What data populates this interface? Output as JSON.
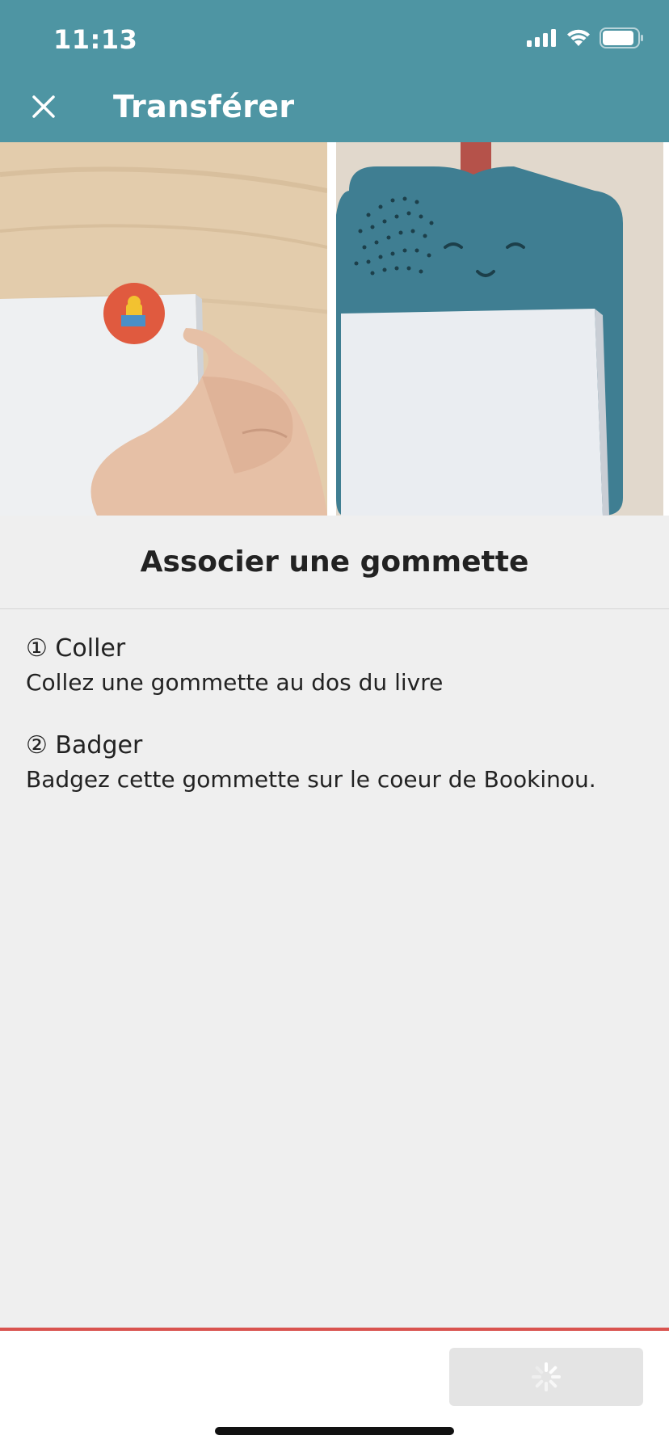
{
  "status_bar": {
    "time": "11:13",
    "icons": [
      "cellular-signal-icon",
      "wifi-icon",
      "battery-icon"
    ]
  },
  "nav": {
    "close_icon": "close-icon",
    "title": "Transférer"
  },
  "images": {
    "left": "photo of hand sticking sticker on book back",
    "right": "photo of book on blue Bookinou device"
  },
  "step": {
    "title": "Associer une gommette"
  },
  "instructions": [
    {
      "heading": "① Coller",
      "text": "Collez une gommette au dos du livre"
    },
    {
      "heading": "② Badger",
      "text": "Badgez cette gommette sur le coeur de Bookinou."
    }
  ],
  "footer": {
    "next_button_state": "loading",
    "spinner_icon": "loading-spinner-icon"
  },
  "colors": {
    "header": "#4e95a3",
    "accent_line": "#d9534f",
    "background": "#efefef"
  }
}
